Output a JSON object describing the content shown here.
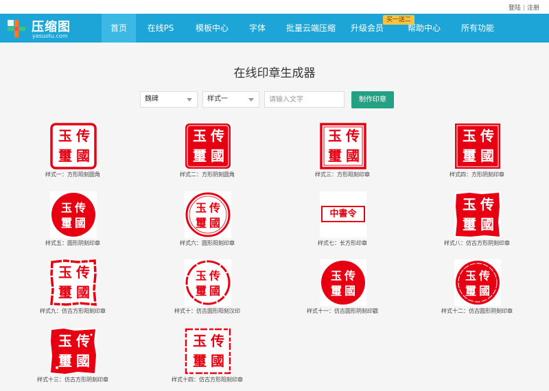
{
  "top_links": {
    "login": "登陆",
    "separator": "|",
    "register": "注册"
  },
  "brand": {
    "name": "压缩图",
    "domain": "yasuotu.com"
  },
  "nav": {
    "items": [
      "首页",
      "在线PS",
      "模板中心",
      "字体",
      "批量云端压缩",
      "升级会员",
      "帮助中心",
      "所有功能"
    ],
    "active_index": 0,
    "promo_badge": "买一送二"
  },
  "page_title": "在线印章生成器",
  "controls": {
    "font_select": "魏碑",
    "style_select": "样式一",
    "text_placeholder": "请输入文字",
    "make_button": "制作印章"
  },
  "seal_text": {
    "top_right": "传",
    "top_left": "玉",
    "bottom_left": "璽",
    "bottom_right": "國",
    "long_seal": "中書令"
  },
  "seal_color": "#e60012",
  "seals": [
    {
      "caption": "样式一：方形阳刻圆角"
    },
    {
      "caption": "样式二：方形阴刻圆角"
    },
    {
      "caption": "样式三：方形阳刻印章"
    },
    {
      "caption": "样式四：方形阴刻印章"
    },
    {
      "caption": "样式五：圆形阴刻印章"
    },
    {
      "caption": "样式六：圆形阳刻印章"
    },
    {
      "caption": "样式七：长方形印章"
    },
    {
      "caption": "样式八：仿古方形阴刻印章"
    },
    {
      "caption": "样式九：仿古方形阳刻印章"
    },
    {
      "caption": "样式十：仿古圆形阳刻汉印"
    },
    {
      "caption": "样式十一：仿古圆形阴刻印戳"
    },
    {
      "caption": "样式十二：仿古圆形阴刻印章"
    },
    {
      "caption": "样式十三：仿古方形阴刻印章"
    },
    {
      "caption": "样式十四：仿古方形阳刻印章"
    }
  ]
}
